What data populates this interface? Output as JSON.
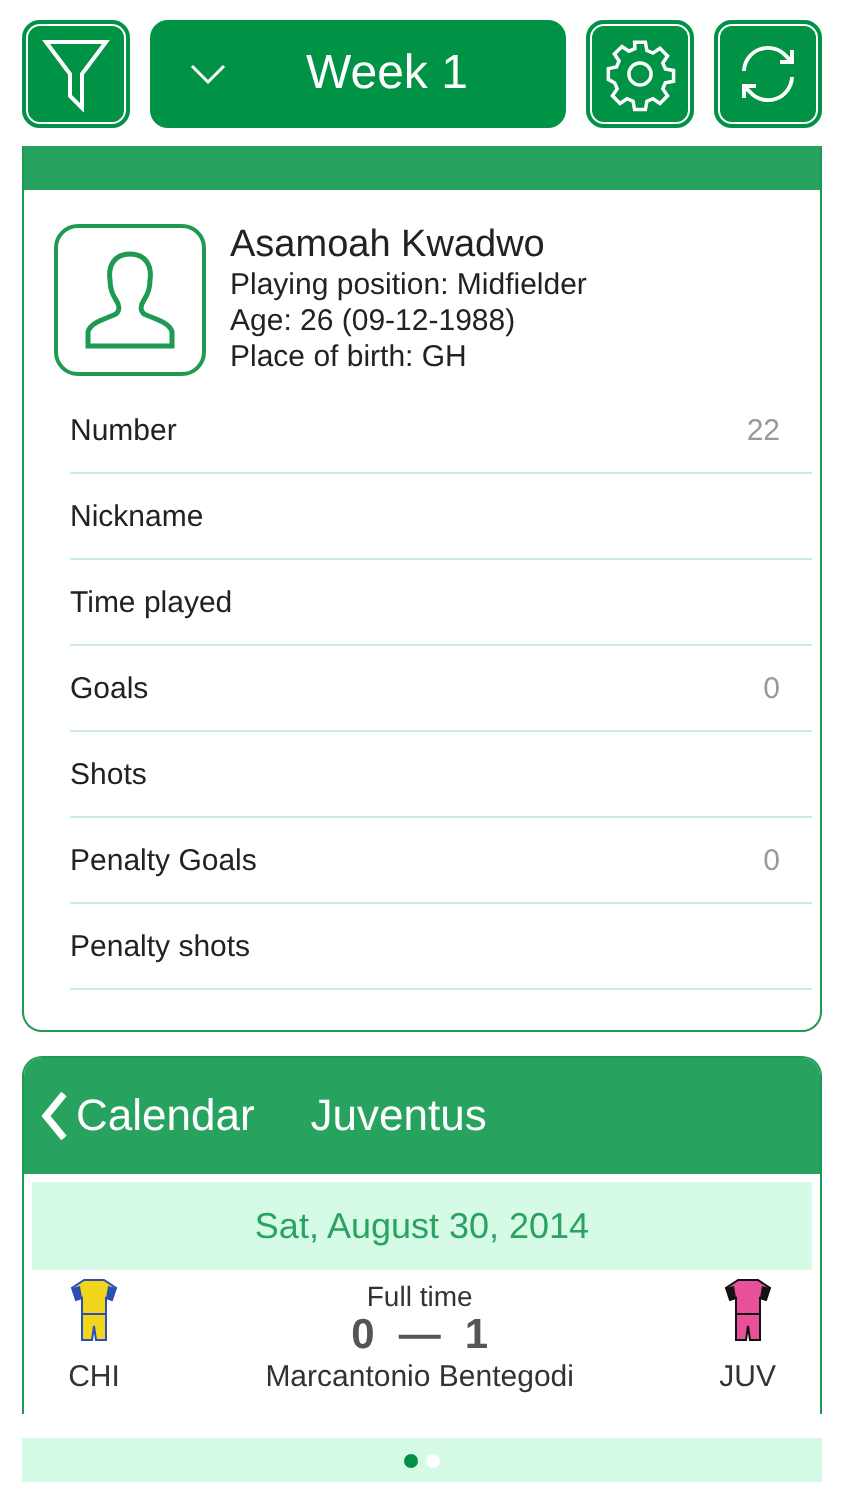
{
  "toolbar": {
    "week": "Week 1"
  },
  "player": {
    "name": "Asamoah Kwadwo",
    "details": [
      "Playing position: Midfielder",
      "Age: 26 (09-12-1988)",
      "Place of birth: GH"
    ],
    "stats": [
      {
        "label": "Number",
        "value": "22"
      },
      {
        "label": "Nickname"
      },
      {
        "label": "Time played"
      },
      {
        "label": "Goals",
        "value": "0"
      },
      {
        "label": "Shots"
      },
      {
        "label": "Penalty Goals",
        "value": "0"
      },
      {
        "label": "Penalty shots"
      }
    ]
  },
  "calendar": {
    "back": "Calendar",
    "team": "Juventus",
    "date": "Sat, August 30, 2014",
    "match": {
      "status": "Full time",
      "home_score": "0",
      "separator": "—",
      "away_score": "1",
      "stadium": "Marcantonio Bentegodi",
      "home": {
        "code": "CHI",
        "color": "#f2d61c"
      },
      "away": {
        "code": "JUV",
        "color": "#e8509a"
      }
    }
  },
  "pager": [
    {
      "selected": true
    },
    {
      "selected": false
    }
  ]
}
